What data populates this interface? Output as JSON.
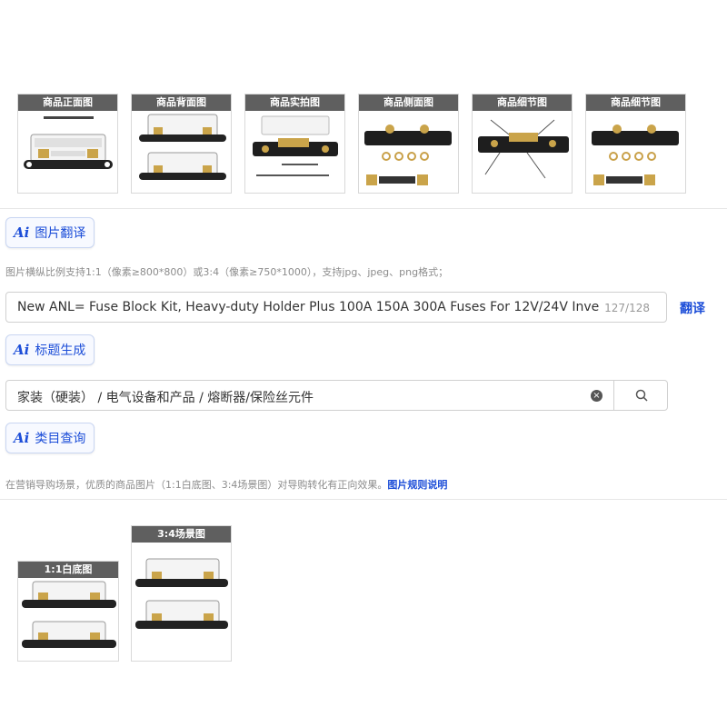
{
  "gallery": {
    "thumbnails": [
      {
        "label": "商品正面图"
      },
      {
        "label": "商品背面图"
      },
      {
        "label": "商品实拍图"
      },
      {
        "label": "商品侧面图"
      },
      {
        "label": "商品细节图"
      },
      {
        "label": "商品细节图"
      }
    ]
  },
  "image_translate": {
    "ai": "Ai",
    "label": "图片翻译"
  },
  "image_hint": "图片横纵比例支持1:1（像素≥800*800）或3:4（像素≥750*1000），支持jpg、jpeg、png格式；",
  "title_field": {
    "value": "New ANL= Fuse Block Kit, Heavy-duty Holder Plus 100A 150A 300A Fuses For 12V/24V Inve",
    "counter": "127/128",
    "translate_label": "翻译"
  },
  "title_generate": {
    "ai": "Ai",
    "label": "标题生成"
  },
  "category_field": {
    "value": "家装（硬装） / 电气设备和产品 / 熔断器/保险丝元件"
  },
  "category_query": {
    "ai": "Ai",
    "label": "类目查询"
  },
  "marketing_hint": {
    "text": "在营销导购场景，优质的商品图片（1:1白底图、3:4场景图）对导购转化有正向效果。",
    "link": "图片规则说明"
  },
  "marketing_images": [
    {
      "label": "1:1白底图"
    },
    {
      "label": "3:4场景图"
    }
  ],
  "colors": {
    "accent": "#1d4ed8",
    "label_bg": "#5f5f5f"
  }
}
